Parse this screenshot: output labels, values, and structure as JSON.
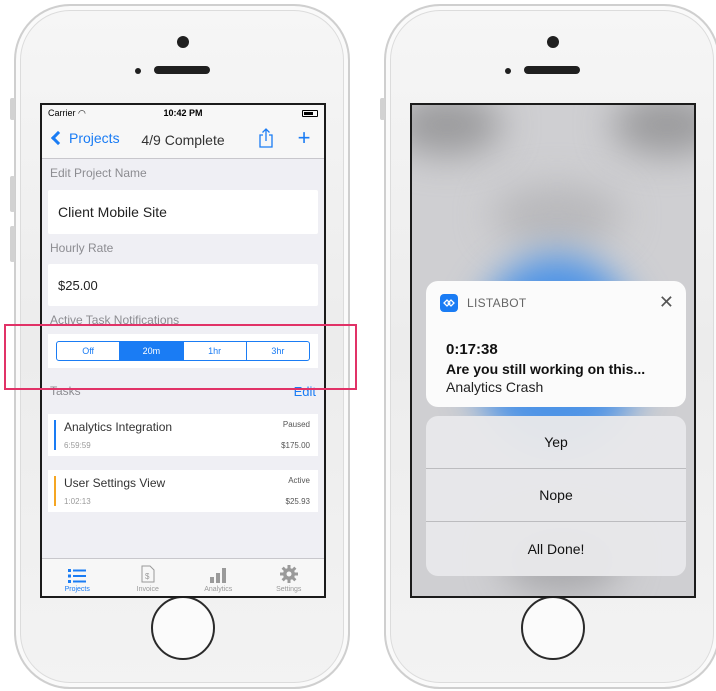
{
  "left": {
    "status": {
      "carrier": "Carrier",
      "time": "10:42 PM"
    },
    "nav": {
      "back_label": "Projects",
      "title": "4/9 Complete"
    },
    "edit_name_label": "Edit Project Name",
    "project_name": "Client Mobile Site",
    "hourly_rate_label": "Hourly Rate",
    "hourly_rate_value": "$25.00",
    "notifications_label": "Active Task Notifications",
    "segments": [
      "Off",
      "20m",
      "1hr",
      "3hr"
    ],
    "selected_segment": "20m",
    "tasks_label": "Tasks",
    "edit_label": "Edit",
    "tasks": [
      {
        "name": "Analytics Integration",
        "duration": "6:59:59",
        "status": "Paused",
        "amount": "$175.00",
        "color": "#1a7cf4"
      },
      {
        "name": "User Settings View",
        "duration": "1:02:13",
        "status": "Active",
        "amount": "$25.93",
        "color": "#f5a623"
      }
    ],
    "tabs": [
      {
        "label": "Projects",
        "icon": "list-icon"
      },
      {
        "label": "Invoice",
        "icon": "invoice-icon"
      },
      {
        "label": "Analytics",
        "icon": "bar-chart-icon"
      },
      {
        "label": "Settings",
        "icon": "gear-icon"
      }
    ]
  },
  "right": {
    "notification": {
      "app_name": "LISTABOT",
      "timer": "0:17:38",
      "message": "Are you still working on this...",
      "task": "Analytics Crash"
    },
    "actions": [
      "Yep",
      "Nope",
      "All Done!"
    ]
  },
  "colors": {
    "accent": "#1a7cf4",
    "highlight": "#e13267",
    "paused_bar": "#1a7cf4",
    "active_bar": "#f5a623"
  }
}
